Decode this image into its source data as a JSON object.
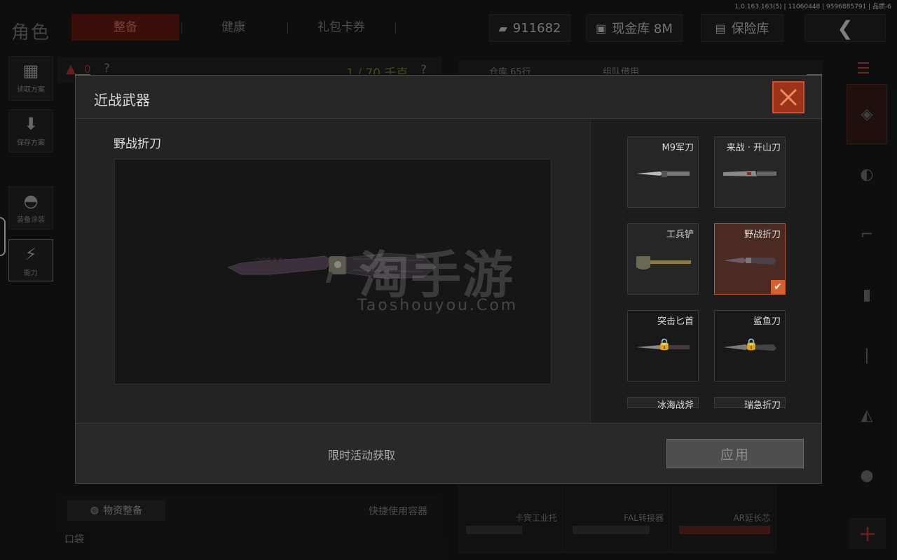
{
  "version_info": "1.0.163.163(5) | 11060448 | 9596885791 | 品质-6",
  "header": {
    "title": "角色",
    "tabs": [
      {
        "label": "整备",
        "active": true
      },
      {
        "label": "健康",
        "active": false
      },
      {
        "label": "礼包卡券",
        "active": false
      }
    ],
    "currency_amount": "911682",
    "cash_vault": "现金库 8M",
    "insurance_vault": "保险库"
  },
  "left_sidebar": {
    "items": [
      {
        "label": "读取方案",
        "icon": "backpack-icon"
      },
      {
        "label": "保存方案",
        "icon": "download-icon"
      },
      {
        "label": "装备涂装",
        "icon": "helmet-icon"
      },
      {
        "label": "能力",
        "icon": "lightning-icon"
      }
    ]
  },
  "inventory": {
    "capacity": "1 / 70 千克",
    "help": "?",
    "counter": "0"
  },
  "warehouse": {
    "tabs": [
      "仓库 65行",
      "组队借用"
    ]
  },
  "bottom": {
    "supply_button": "物资整备",
    "quick_use": "快捷使用容器",
    "pocket": "口袋",
    "parts": [
      "卡宾工业托",
      "FAL转接器",
      "AR延长芯"
    ]
  },
  "modal": {
    "title": "近战武器",
    "selected_item": "野战折刀",
    "watermark_cn": "淘手游",
    "watermark_en": "Taoshouyou.Com",
    "weapons": [
      {
        "name": "M9军刀",
        "locked": false,
        "selected": false,
        "icon": "bayonet-icon"
      },
      {
        "name": "来战 · 开山刀",
        "locked": false,
        "selected": false,
        "icon": "machete-icon"
      },
      {
        "name": "工兵铲",
        "locked": false,
        "selected": false,
        "icon": "shovel-icon"
      },
      {
        "name": "野战折刀",
        "locked": false,
        "selected": true,
        "icon": "folding-knife-icon"
      },
      {
        "name": "突击匕首",
        "locked": true,
        "selected": false,
        "icon": "dagger-icon"
      },
      {
        "name": "鲨鱼刀",
        "locked": true,
        "selected": false,
        "icon": "shark-knife-icon"
      },
      {
        "name": "冰海战斧",
        "locked": false,
        "selected": false,
        "icon": "axe-icon"
      },
      {
        "name": "瑞急折刀",
        "locked": false,
        "selected": false,
        "icon": "knife-icon"
      }
    ],
    "acquire_text": "限时活动获取",
    "apply_label": "应用"
  },
  "colors": {
    "accent_red": "#c0512c",
    "active_tab_bg": "#6b1d12",
    "capacity_green": "#6a8f2c"
  }
}
